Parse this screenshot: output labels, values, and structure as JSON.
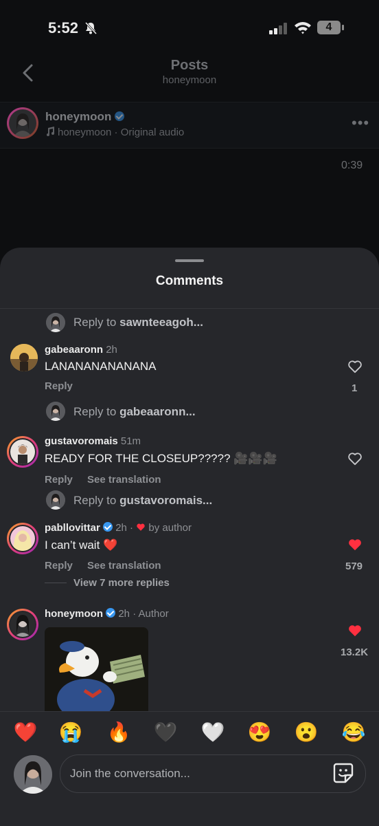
{
  "status_bar": {
    "time": "5:52",
    "battery": "4"
  },
  "header": {
    "title": "Posts",
    "subtitle": "honeymoon"
  },
  "post": {
    "username": "honeymoon",
    "audio": "honeymoon · Original audio",
    "duration": "0:39"
  },
  "sheet": {
    "title": "Comments"
  },
  "reply_prefix": "Reply to ",
  "reply_rows": [
    {
      "target": "sawnteeagoh..."
    },
    {
      "target": "gabeaaronn..."
    },
    {
      "target": "gustavoromais..."
    }
  ],
  "comments": [
    {
      "username": "gabeaaronn",
      "meta": "2h",
      "text": "LANANANANANANA",
      "reply": "Reply",
      "likes": "1",
      "liked": false
    },
    {
      "username": "gustavoromais",
      "meta": "51m",
      "text": "READY FOR THE CLOSEUP????? 🎥🎥🎥",
      "reply": "Reply",
      "translation": "See translation",
      "liked": false
    },
    {
      "username": "pabllovittar",
      "meta": "2h ·",
      "by_author": "by author",
      "text": "I can’t wait ❤️",
      "reply": "Reply",
      "translation": "See translation",
      "likes": "579",
      "liked": true,
      "more_replies": "View 7 more replies"
    },
    {
      "username": "honeymoon",
      "meta": "2h · Author",
      "likes": "13.2K",
      "liked": true
    }
  ],
  "reactions": [
    "❤️",
    "😭",
    "🔥",
    "🖤",
    "🤍",
    "😍",
    "😮",
    "😂"
  ],
  "composer": {
    "placeholder": "Join the conversation..."
  },
  "colors": {
    "sheet": "#26272b",
    "like_red": "#ff3040",
    "verified_blue": "#3897f0"
  }
}
